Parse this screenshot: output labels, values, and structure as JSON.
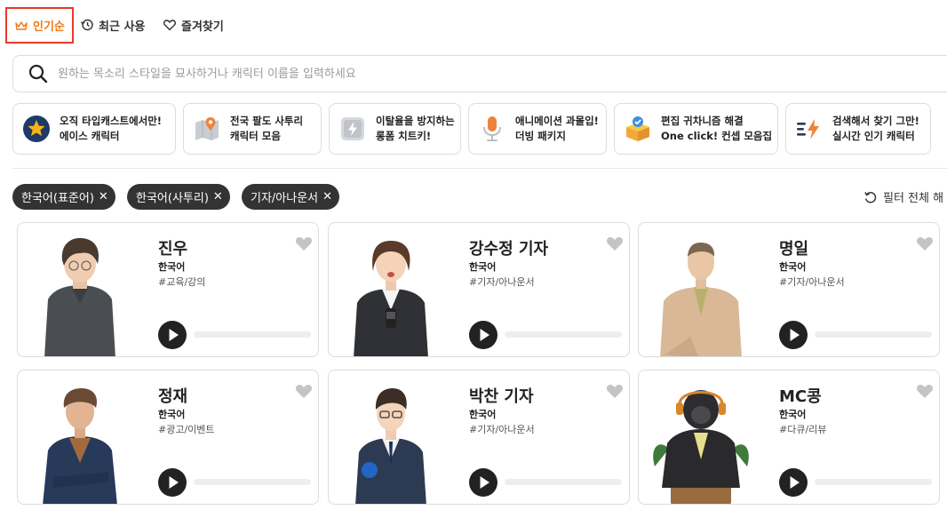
{
  "sort_tabs": [
    {
      "label": "인기순",
      "icon": "crown-icon",
      "active": true
    },
    {
      "label": "최근 사용",
      "icon": "history-icon",
      "active": false
    },
    {
      "label": "즐겨찾기",
      "icon": "heart-icon",
      "active": false
    }
  ],
  "search": {
    "placeholder": "원하는 목소리 스타일을 묘사하거나 캐릭터 이름을 입력하세요",
    "value": ""
  },
  "quick_categories": [
    {
      "line1": "오직 타입캐스트에서만!",
      "line2": "에이스 캐릭터",
      "icon": "star-badge-icon"
    },
    {
      "line1": "전국 팔도 사투리",
      "line2": "캐릭터 모음",
      "icon": "map-pin-icon"
    },
    {
      "line1": "이탈율을 방지하는",
      "line2": "롱폼 치트키!",
      "icon": "lightning-icon"
    },
    {
      "line1": "애니메이션 과몰입!",
      "line2": "더빙 패키지",
      "icon": "microphone-icon"
    },
    {
      "line1": "편집 귀차니즘 해결",
      "line2": "One click! 컨셉 모음집",
      "icon": "box-check-icon"
    },
    {
      "line1": "검색해서 찾기 그만!",
      "line2": "실시간 인기 캐릭터",
      "icon": "trending-bolt-icon"
    }
  ],
  "filters": [
    {
      "label": "한국어(표준어)"
    },
    {
      "label": "한국어(사투리)"
    },
    {
      "label": "기자/아나운서"
    }
  ],
  "reset_label": "필터 전체 해",
  "characters": [
    {
      "name": "진우",
      "language": "한국어",
      "tag": "#교육/강의"
    },
    {
      "name": "강수정 기자",
      "language": "한국어",
      "tag": "#기자/아나운서"
    },
    {
      "name": "명일",
      "language": "한국어",
      "tag": "#기자/아나운서"
    },
    {
      "name": "정재",
      "language": "한국어",
      "tag": "#광고/이벤트"
    },
    {
      "name": "박찬 기자",
      "language": "한국어",
      "tag": "#기자/아나운서"
    },
    {
      "name": "MC콩",
      "language": "한국어",
      "tag": "#다큐/리뷰"
    }
  ],
  "colors": {
    "accent": "#f07a16",
    "active_border": "#e53b2c",
    "chip_bg": "#333333"
  }
}
